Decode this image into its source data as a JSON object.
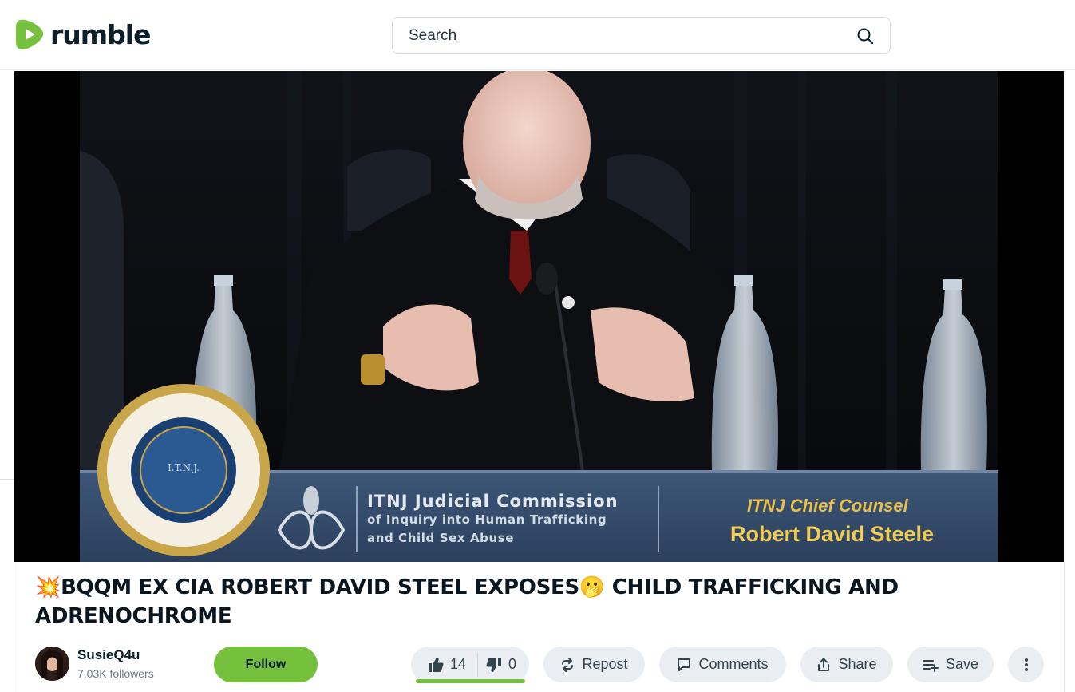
{
  "brand": {
    "name": "rumble",
    "color": "#75c03c"
  },
  "search": {
    "placeholder": "Search"
  },
  "video": {
    "lower_third": {
      "seal_text": "I.T.N.J.",
      "org_line1": "ITNJ Judicial Commission",
      "org_line2": "of Inquiry into Human Trafficking",
      "org_line3": "and Child Sex Abuse",
      "role": "ITNJ Chief Counsel",
      "speaker": "Robert David Steele"
    }
  },
  "title": {
    "emoji_start": "💥",
    "part1": "BQQM EX CIA ROBERT DAVID STEEL EXPOSES",
    "emoji_mid": "🫢",
    "part2": " CHILD TRAFFICKING AND ADRENOCHROME"
  },
  "channel": {
    "name": "SusieQ4u",
    "followers": "7.03K followers"
  },
  "actions": {
    "follow": "Follow",
    "likes": "14",
    "dislikes": "0",
    "repost": "Repost",
    "comments": "Comments",
    "share": "Share",
    "save": "Save"
  }
}
